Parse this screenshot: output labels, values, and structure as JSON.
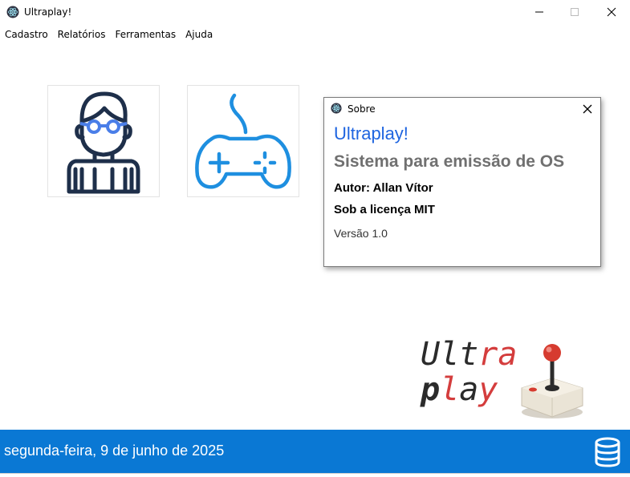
{
  "window": {
    "title": "Ultraplay!",
    "icon": "electron-icon",
    "controls": [
      "minimize",
      "maximize",
      "close"
    ]
  },
  "menu": {
    "items": [
      {
        "label": "Cadastro"
      },
      {
        "label": "Relatórios"
      },
      {
        "label": "Ferramentas"
      },
      {
        "label": "Ajuda"
      }
    ]
  },
  "tiles": [
    {
      "icon": "user-with-glasses-icon"
    },
    {
      "icon": "gamepad-icon"
    }
  ],
  "dialog": {
    "title": "Sobre",
    "heading": "Ultraplay!",
    "subtitle": "Sistema para emissão de OS",
    "author": "Autor: Allan Vítor",
    "license": "Sob a licença MIT",
    "version": "Versão 1.0"
  },
  "logo": {
    "line1": "Ultra",
    "line2": "play",
    "icon": "joystick-icon"
  },
  "statusbar": {
    "date": "segunda-feira, 9 de junho de 2025",
    "icon": "database-icon"
  },
  "colors": {
    "accent": "#0a78d4",
    "heading_blue": "#1f65e0",
    "logo_red": "#d43d3d"
  }
}
